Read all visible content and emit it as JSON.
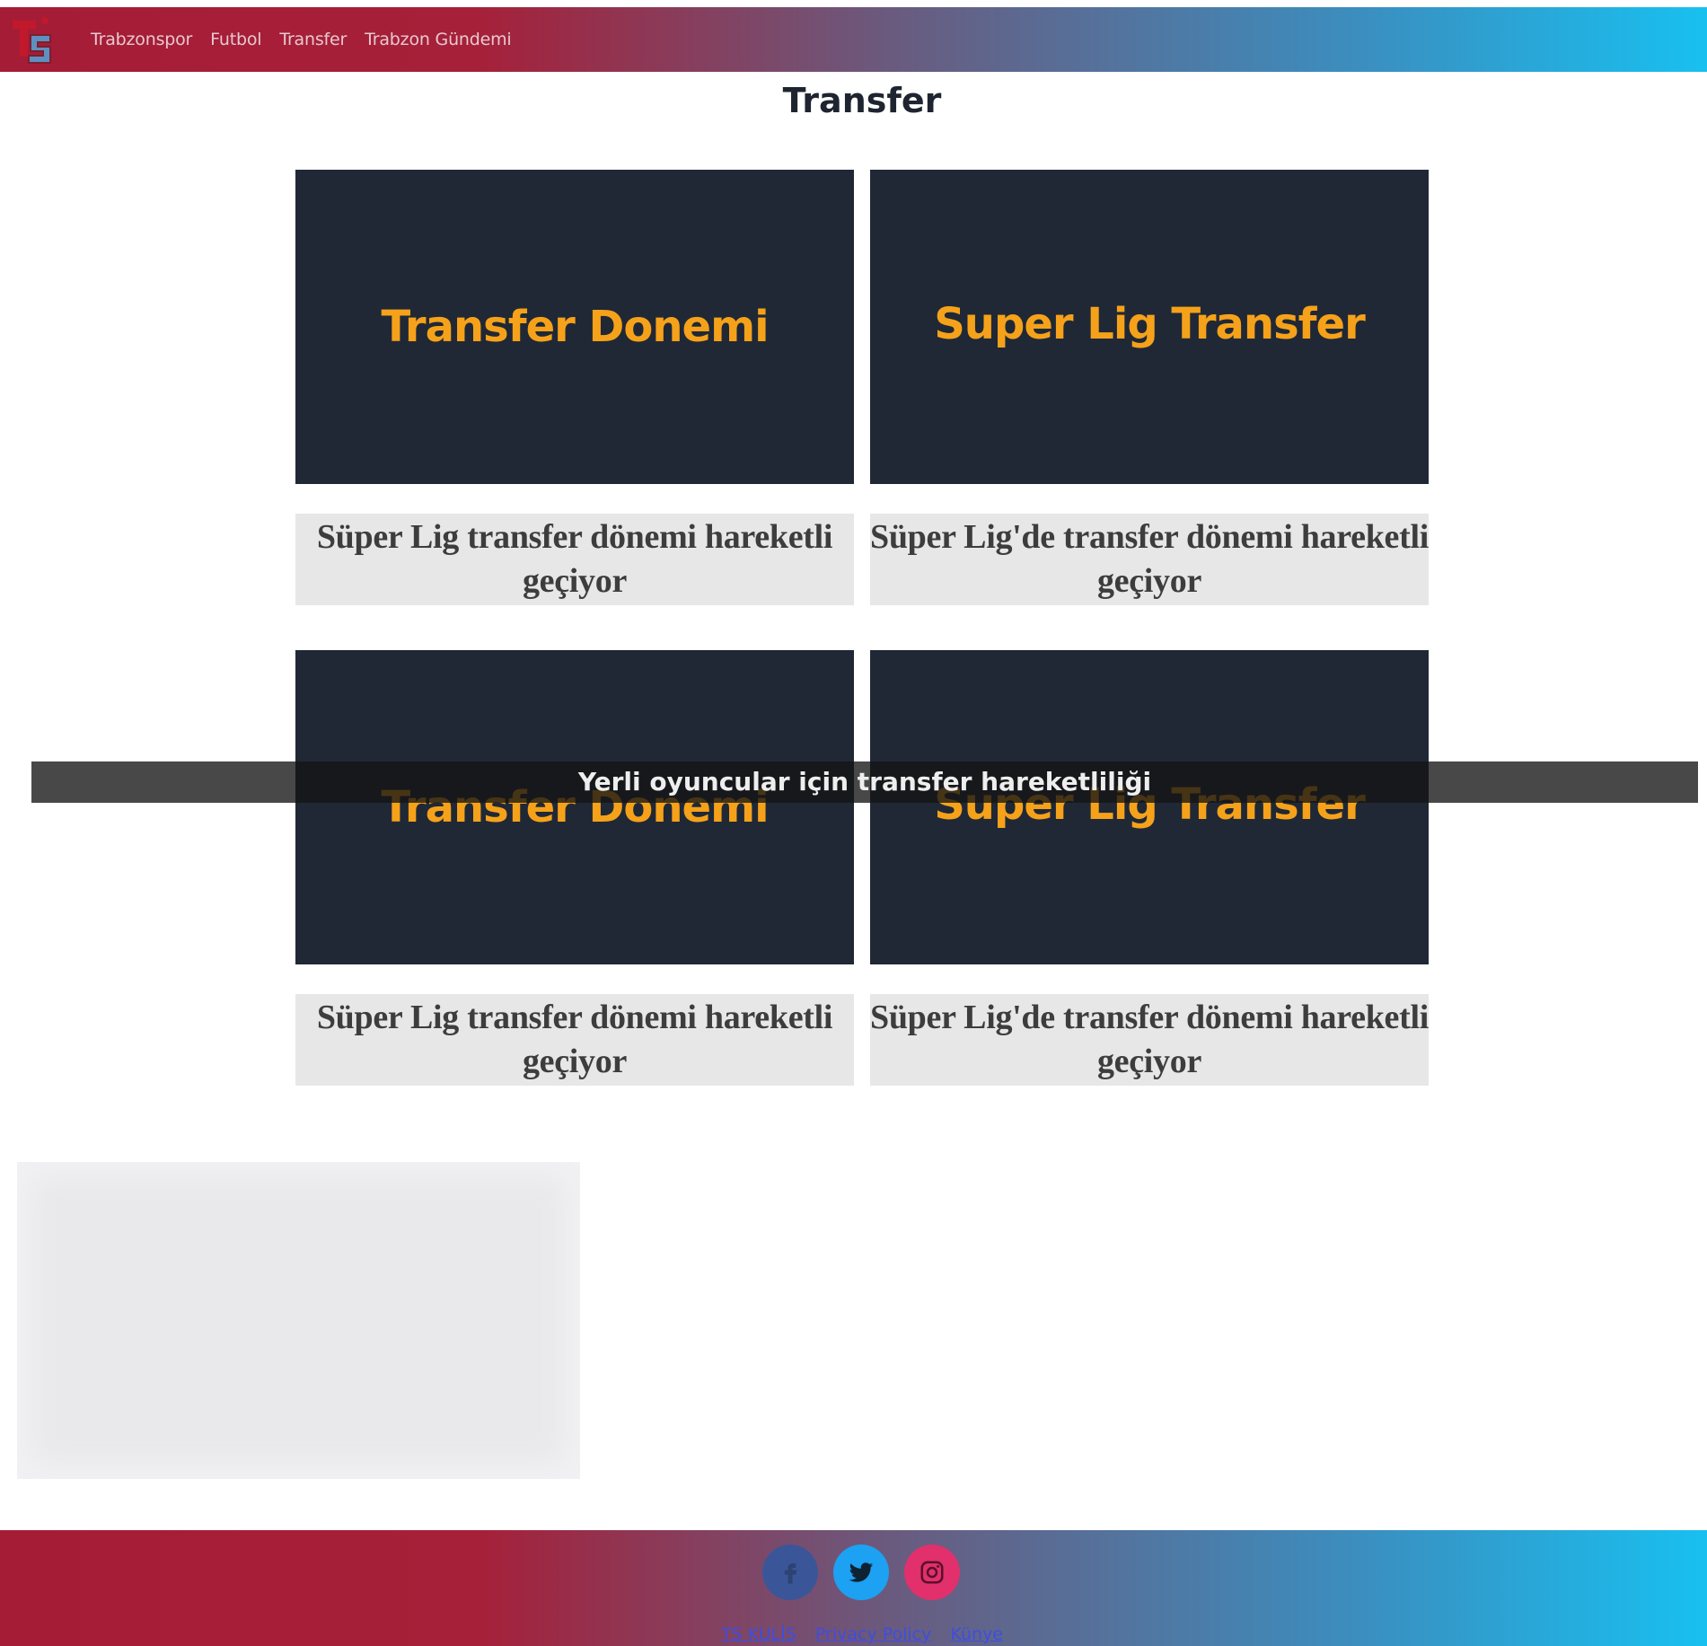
{
  "nav": {
    "logo_text": "TS",
    "links": [
      "Trabzonspor",
      "Futbol",
      "Transfer",
      "Trabzon Gündemi"
    ]
  },
  "page": {
    "title": "Transfer"
  },
  "cards": [
    {
      "image_text": "Transfer Donemi",
      "caption": "Süper Lig transfer dönemi hareketli geçiyor"
    },
    {
      "image_text": "Super Lig Transfer",
      "caption": "Süper Lig'de transfer dönemi hareketli geçiyor"
    },
    {
      "image_text": "Transfer Donemi",
      "caption": "Süper Lig transfer dönemi hareketli geçiyor"
    },
    {
      "image_text": "Super Lig Transfer",
      "caption": "Süper Lig'de transfer dönemi hareketli geçiyor"
    }
  ],
  "overlay": {
    "text": "Yerli oyuncular için transfer hareketliliği"
  },
  "footer": {
    "social": [
      "facebook-icon",
      "twitter-icon",
      "instagram-icon"
    ],
    "links": [
      "TS KULİS",
      "Privacy Policy",
      "Künye"
    ]
  },
  "colors": {
    "brand_red": "#a51c36",
    "brand_blue": "#18c0f0",
    "card_bg": "#202836",
    "card_text": "#f5a21a"
  }
}
